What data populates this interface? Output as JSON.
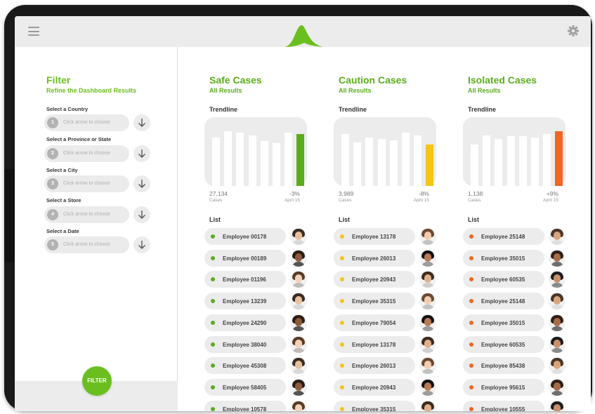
{
  "filter": {
    "title": "Filter",
    "subtitle": "Refine the Dashboard Results",
    "fields": [
      {
        "label": "Select a Country",
        "number": "1",
        "placeholder": "Click arrow to choose"
      },
      {
        "label": "Select a Province or State",
        "number": "2",
        "placeholder": "Click arrow to choose"
      },
      {
        "label": "Select a City",
        "number": "3",
        "placeholder": "Click arrow to choose"
      },
      {
        "label": "Select a Store",
        "number": "4",
        "placeholder": "Click arrow to choose"
      },
      {
        "label": "Select a Date",
        "number": "5",
        "placeholder": "Click arrow to choose"
      }
    ],
    "button_label": "FILTER"
  },
  "icons": {
    "menu": "menu-icon",
    "logo": "logo-icon",
    "settings": "gear-icon",
    "arrow": "arrow-down-icon"
  },
  "colors": {
    "brand": "#6abf1f",
    "safe": "#5aad1a",
    "caution": "#f5c518",
    "isolated": "#f26522"
  },
  "columns": [
    {
      "title": "Safe Cases",
      "subtitle": "All Results",
      "trend_label": "Trendline",
      "trend": [
        0.7,
        0.8,
        0.78,
        0.73,
        0.65,
        0.62,
        0.78,
        0.76
      ],
      "cases": "27,134",
      "cases_label": "Cases",
      "change": "-3%",
      "date": "April 15",
      "list_label": "List",
      "employees": [
        "Employee 00178",
        "Employee 00189",
        "Employee 01196",
        "Employee 13239",
        "Employee 24290",
        "Employee 38040",
        "Employee 45308",
        "Employee 58405",
        "Employee 10578"
      ]
    },
    {
      "title": "Caution Cases",
      "subtitle": "All Results",
      "trend_label": "Trendline",
      "trend": [
        0.75,
        0.63,
        0.7,
        0.68,
        0.66,
        0.78,
        0.73,
        0.6
      ],
      "cases": "3,989",
      "cases_label": "Cases",
      "change": "-8%",
      "date": "April 15",
      "list_label": "List",
      "employees": [
        "Employee 13178",
        "Employee 26013",
        "Employee 20943",
        "Employee 35315",
        "Employee 79054",
        "Employee 13178",
        "Employee 26013",
        "Employee 20943",
        "Employee 35315"
      ]
    },
    {
      "title": "Isolated Cases",
      "subtitle": "All Results",
      "trend_label": "Trendline",
      "trend": [
        0.6,
        0.73,
        0.68,
        0.72,
        0.72,
        0.7,
        0.76,
        0.8
      ],
      "cases": "1,138",
      "cases_label": "Cases",
      "change": "+9%",
      "date": "April 15",
      "list_label": "List",
      "employees": [
        "Employee 25148",
        "Employee 35015",
        "Employee 60535",
        "Employee 25148",
        "Employee 35015",
        "Employee 60535",
        "Employee 85438",
        "Employee 95615",
        "Employee 10555"
      ]
    }
  ]
}
